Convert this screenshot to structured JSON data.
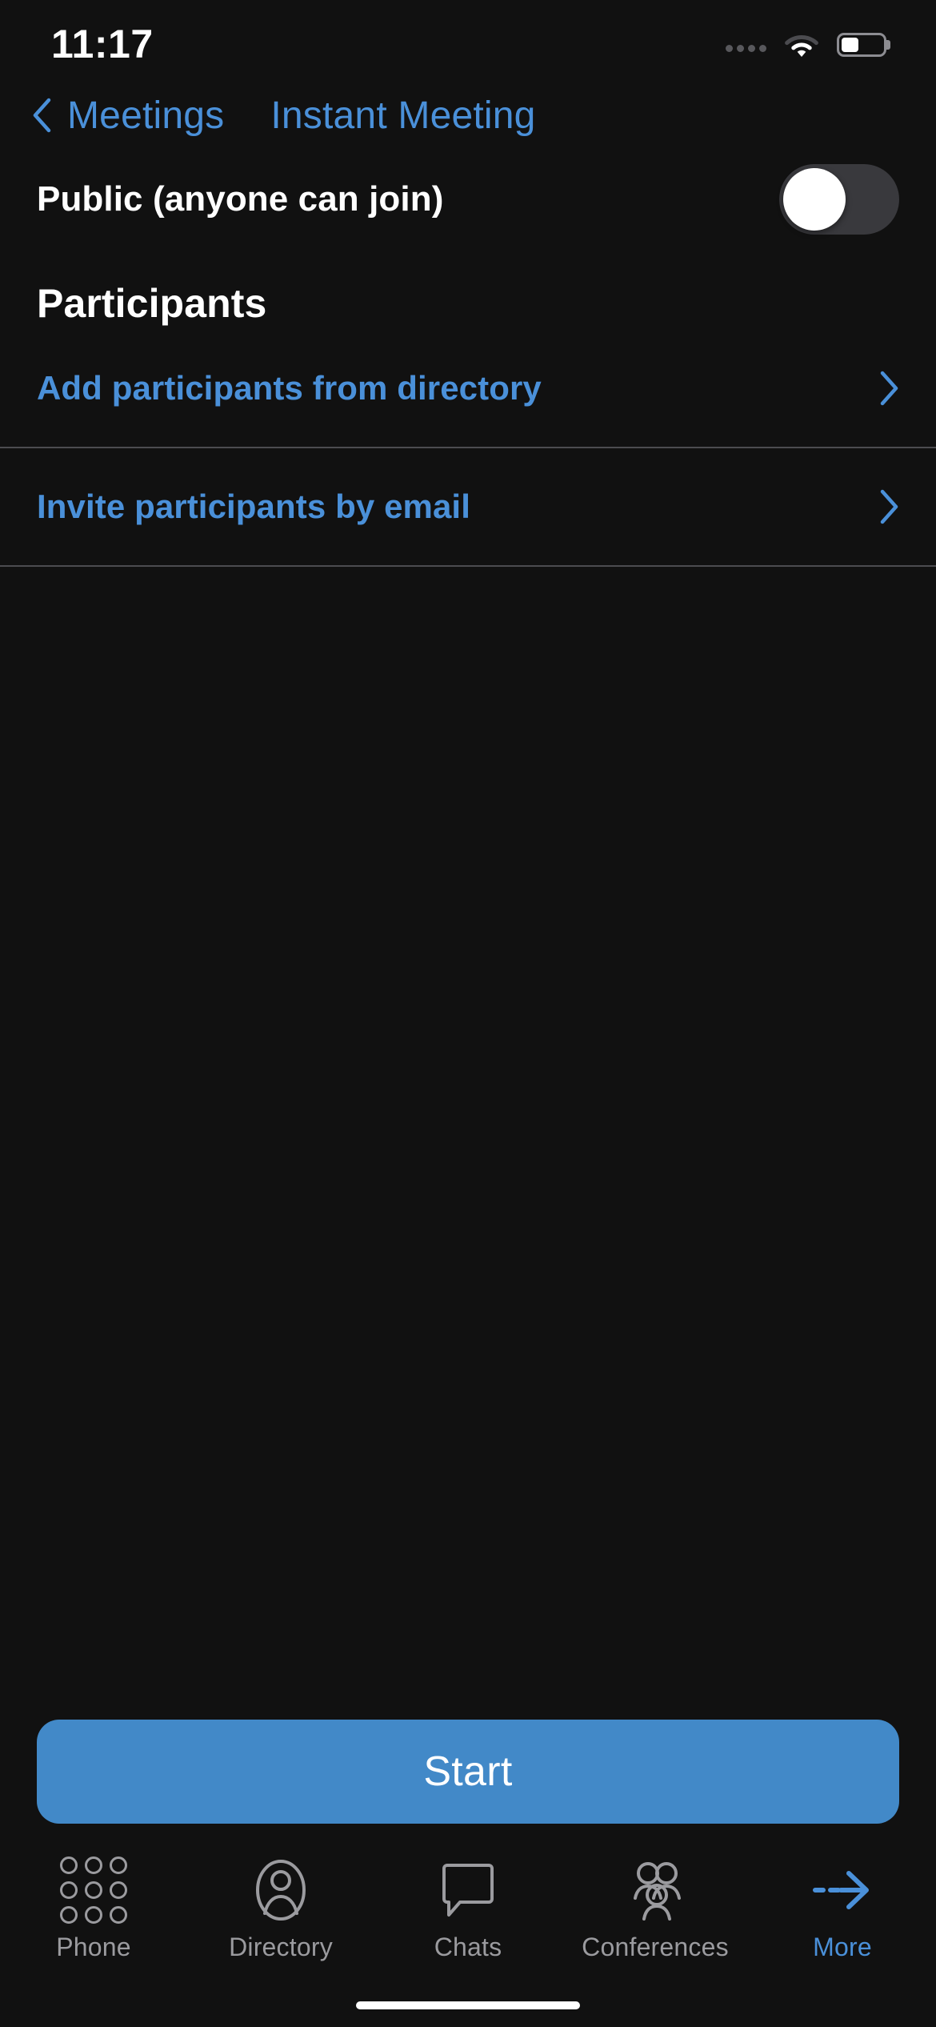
{
  "status_bar": {
    "time": "11:17",
    "signal_icon": "signal-dots-icon",
    "wifi_icon": "wifi-icon",
    "battery_icon": "battery-icon",
    "battery_level_percent": 42
  },
  "nav_bar": {
    "back_icon": "chevron-left-icon",
    "back_label": "Meetings",
    "title": "Instant Meeting"
  },
  "settings": {
    "public_toggle": {
      "label": "Public (anyone can join)",
      "state": "off"
    }
  },
  "participants": {
    "section_title": "Participants",
    "rows": [
      {
        "label": "Add participants from directory",
        "chevron": "chevron-right-icon"
      },
      {
        "label": "Invite participants by email",
        "chevron": "chevron-right-icon"
      }
    ]
  },
  "actions": {
    "start_label": "Start"
  },
  "tab_bar": {
    "items": [
      {
        "label": "Phone",
        "icon": "dialpad-icon",
        "active": false
      },
      {
        "label": "Directory",
        "icon": "person-icon",
        "active": false
      },
      {
        "label": "Chats",
        "icon": "chat-bubble-icon",
        "active": false
      },
      {
        "label": "Conferences",
        "icon": "people-group-icon",
        "active": false
      },
      {
        "label": "More",
        "icon": "arrow-right-icon",
        "active": true
      }
    ]
  },
  "colors": {
    "background": "#111111",
    "accent_blue": "#4A90D9",
    "button_blue": "#4289C8",
    "switch_track_off": "#39393D",
    "divider": "#4c4c50",
    "tab_inactive": "#9b9b9f"
  }
}
